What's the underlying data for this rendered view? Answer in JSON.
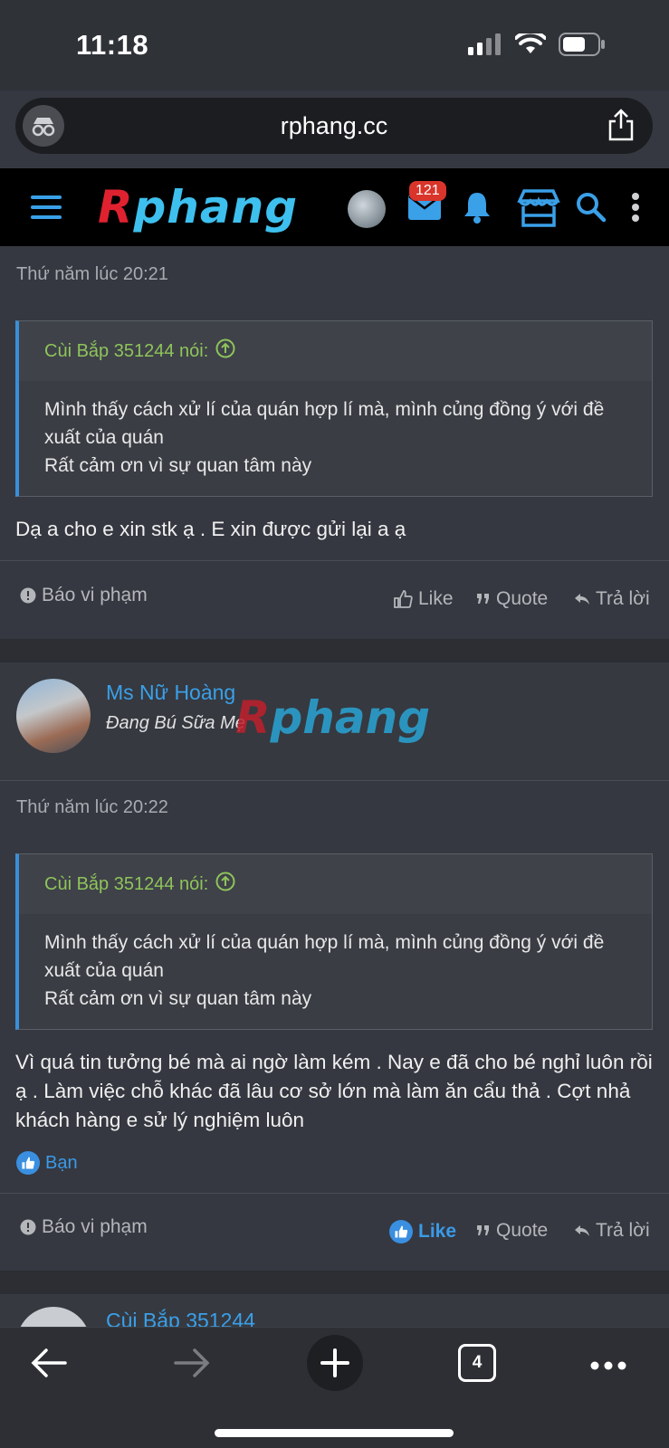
{
  "status_bar": {
    "time": "11:18"
  },
  "browser": {
    "url": "rphang.cc",
    "tab_count": "4"
  },
  "site_header": {
    "logo_r": "R",
    "logo_rest": "phang",
    "notification_count": "121"
  },
  "post1": {
    "date": "Thứ năm lúc 20:21",
    "quote_author": "Cùi Bắp 351244 nói:",
    "quote_lines": [
      "Mình thấy cách xử lí của quán hợp lí mà, mình củng đồng ý với đề xuất của quán",
      "Rất cảm ơn vì sự quan tâm này"
    ],
    "text": "Dạ a cho e xin stk ạ . E xin được gửi lại a ạ",
    "report": "Báo vi phạm",
    "like": "Like",
    "quote": "Quote",
    "reply": "Trả lời"
  },
  "post2": {
    "author": "Ms Nữ Hoàng",
    "author_title": "Đang Bú Sữa Mẹ",
    "date": "Thứ năm lúc 20:22",
    "quote_author": "Cùi Bắp 351244 nói:",
    "quote_lines": [
      "Mình thấy cách xử lí của quán hợp lí mà, mình củng đồng ý với đề xuất của quán",
      "Rất cảm ơn vì sự quan tâm này"
    ],
    "text": "Vì quá tin tưởng bé mà ai ngờ làm kém . Nay e đã cho bé nghỉ luôn rồi ạ . Làm việc chỗ khác đã lâu cơ sở lớn mà làm ăn cẩu thả . Cợt nhả khách hàng e sử lý nghiệm luôn",
    "reaction": "Bạn",
    "report": "Báo vi phạm",
    "like": "Like",
    "quote": "Quote",
    "reply": "Trả lời"
  },
  "post3": {
    "author": "Cùi Bắp 351244"
  },
  "watermark": {
    "r": "R",
    "rest": "phang"
  },
  "colors": {
    "accent": "#3aa0e8",
    "quote_author": "#8fc45a",
    "badge": "#d9352b"
  }
}
